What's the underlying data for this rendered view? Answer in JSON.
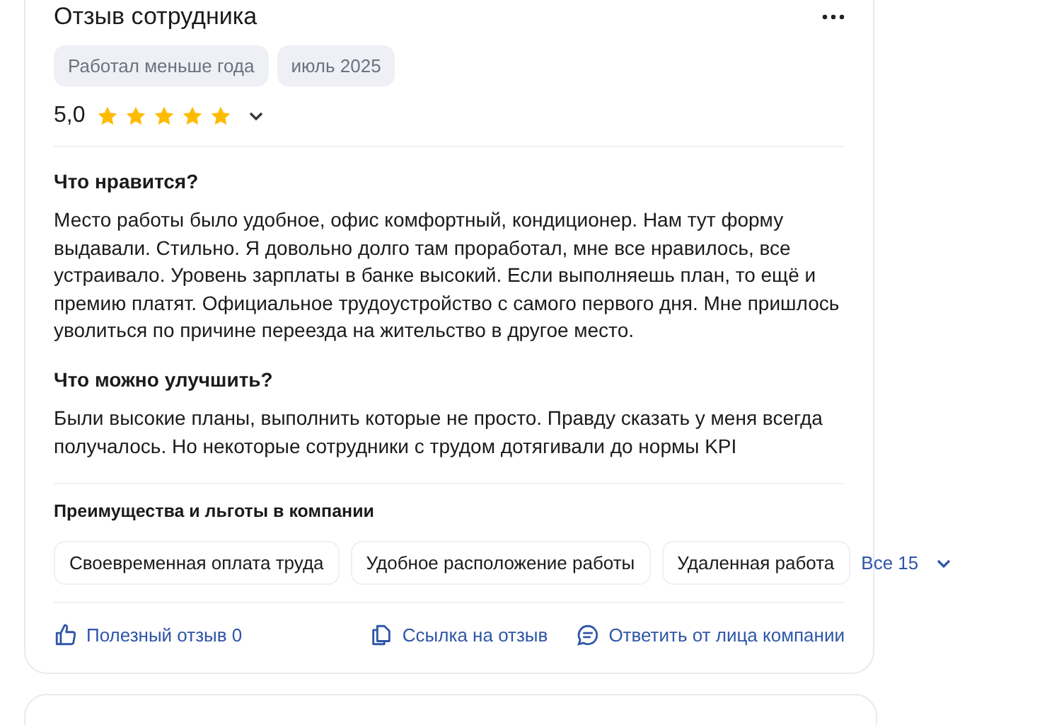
{
  "review": {
    "title": "Отзыв сотрудника",
    "tags": [
      "Работал меньше года",
      "июль 2025"
    ],
    "rating": "5,0",
    "stars": 5,
    "sections": [
      {
        "heading": "Что нравится?",
        "text": "Место работы было удобное, офис комфортный, кондиционер. Нам тут форму выдавали. Стильно. Я довольно долго там проработал, мне все нравилось, все устраивало. Уровень зарплаты в банке высокий. Если выполняешь план, то ещё и премию платят. Официальное трудоустройство с самого первого дня. Мне пришлось уволиться по причине переезда на жительство в другое место."
      },
      {
        "heading": "Что можно улучшить?",
        "text": "Были высокие планы, выполнить которые не просто. Правду сказать у меня всегда получалось. Но некоторые сотрудники с трудом дотягивали до нормы KPI"
      }
    ],
    "benefits": {
      "heading": "Преимущества и льготы в компании",
      "items": [
        "Своевременная оплата труда",
        "Удобное расположение работы",
        "Удаленная работа"
      ],
      "more": "Все 15"
    },
    "actions": [
      {
        "kind": "like",
        "label": "Полезный отзыв 0"
      },
      {
        "kind": "link",
        "label": "Ссылка на отзыв"
      },
      {
        "kind": "reply",
        "label": "Ответить от лица компании"
      }
    ]
  }
}
